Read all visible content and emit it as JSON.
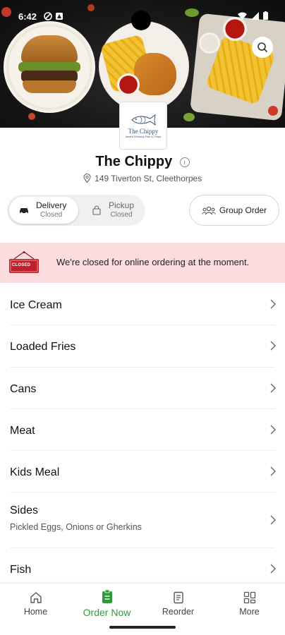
{
  "status_bar": {
    "time": "6:42"
  },
  "hero": {
    "search_icon": "search-icon"
  },
  "restaurant": {
    "logo_name": "The Chippy",
    "logo_tagline": "Award Winning Fish & Chips",
    "name": "The Chippy",
    "address": "149 Tiverton St, Cleethorpes"
  },
  "order_mode": {
    "delivery_label": "Delivery",
    "delivery_status": "Closed",
    "pickup_label": "Pickup",
    "pickup_status": "Closed",
    "selected": "Delivery"
  },
  "group_order_label": "Group Order",
  "banner": {
    "sign_text": "CLOSED",
    "message": "We're closed for online ordering at the moment."
  },
  "menu": [
    {
      "title": "Ice Cream"
    },
    {
      "title": "Loaded Fries"
    },
    {
      "title": "Cans"
    },
    {
      "title": "Meat"
    },
    {
      "title": "Kids Meal"
    },
    {
      "title": "Sides",
      "subtitle": "Pickled Eggs, Onions or Gherkins"
    },
    {
      "title": "Fish"
    }
  ],
  "bottom_nav": [
    {
      "label": "Home",
      "icon": "home-icon"
    },
    {
      "label": "Order Now",
      "icon": "order-icon",
      "active": true
    },
    {
      "label": "Reorder",
      "icon": "receipt-icon"
    },
    {
      "label": "More",
      "icon": "grid-icon"
    }
  ],
  "colors": {
    "accent_green": "#2e9b3a",
    "banner_bg": "#fbdde0",
    "closed_red": "#c0202a"
  }
}
